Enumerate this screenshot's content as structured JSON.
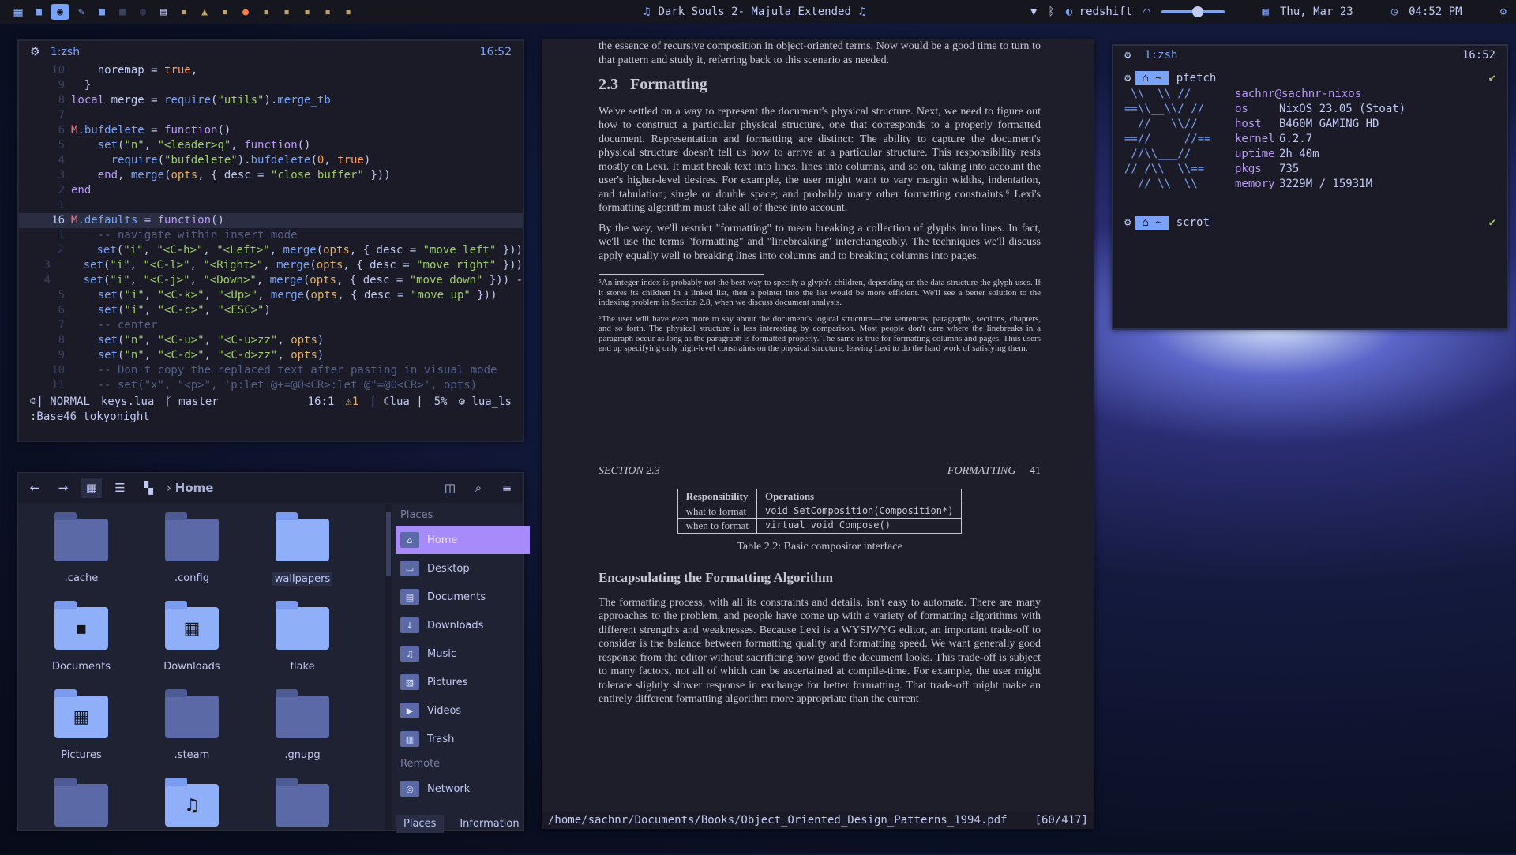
{
  "topbar": {
    "workspace_count": 16,
    "media": "Dark Souls 2- Majula Extended",
    "redshift": "redshift",
    "volume_level": 0.58,
    "date": "Thu, Mar 23",
    "time": "04:52 PM"
  },
  "editor": {
    "title": "1:zsh",
    "clock": "16:52",
    "lines": [
      {
        "n": "10",
        "segs": [
          [
            "o",
            "    noremap = "
          ],
          [
            "b",
            "true"
          ],
          [
            "o",
            ","
          ]
        ]
      },
      {
        "n": "9",
        "segs": [
          [
            "o",
            "  }"
          ]
        ]
      },
      {
        "n": "8",
        "segs": [
          [
            "k",
            "local "
          ],
          [
            "o",
            "merge = "
          ],
          [
            "f",
            "require"
          ],
          [
            "o",
            "("
          ],
          [
            "s",
            "\"utils\""
          ],
          [
            "o",
            ")."
          ],
          [
            "f",
            "merge_tb"
          ]
        ]
      },
      {
        "n": "7",
        "segs": []
      },
      {
        "n": "6",
        "segs": [
          [
            "r",
            "M"
          ],
          [
            "o",
            "."
          ],
          [
            "f",
            "bufdelete"
          ],
          [
            "o",
            " = "
          ],
          [
            "k",
            "function"
          ],
          [
            "o",
            "()"
          ]
        ]
      },
      {
        "n": "5",
        "segs": [
          [
            "o",
            "    "
          ],
          [
            "f",
            "set"
          ],
          [
            "o",
            "("
          ],
          [
            "s",
            "\"n\""
          ],
          [
            "o",
            ", "
          ],
          [
            "s",
            "\"<leader>q\""
          ],
          [
            "o",
            ", "
          ],
          [
            "k",
            "function"
          ],
          [
            "o",
            "()"
          ]
        ]
      },
      {
        "n": "4",
        "segs": [
          [
            "o",
            "      "
          ],
          [
            "f",
            "require"
          ],
          [
            "o",
            "("
          ],
          [
            "s",
            "\"bufdelete\""
          ],
          [
            "o",
            ")."
          ],
          [
            "f",
            "bufdelete"
          ],
          [
            "o",
            "("
          ],
          [
            "b",
            "0"
          ],
          [
            "o",
            ", "
          ],
          [
            "b",
            "true"
          ],
          [
            "o",
            ")"
          ]
        ]
      },
      {
        "n": "3",
        "segs": [
          [
            "o",
            "    "
          ],
          [
            "k",
            "end"
          ],
          [
            "o",
            ", "
          ],
          [
            "f",
            "merge"
          ],
          [
            "o",
            "("
          ],
          [
            "y",
            "opts"
          ],
          [
            "o",
            ", { desc = "
          ],
          [
            "s",
            "\"close buffer\""
          ],
          [
            "o",
            " }))"
          ]
        ]
      },
      {
        "n": "2",
        "segs": [
          [
            "k",
            "end"
          ]
        ]
      },
      {
        "n": "1",
        "segs": []
      },
      {
        "n": "16",
        "cur": true,
        "segs": [
          [
            "r",
            "M"
          ],
          [
            "o",
            "."
          ],
          [
            "f",
            "defaults"
          ],
          [
            "o",
            " = "
          ],
          [
            "k",
            "function"
          ],
          [
            "o",
            "()"
          ]
        ]
      },
      {
        "n": "1",
        "segs": [
          [
            "c",
            "    -- navigate within insert mode"
          ]
        ]
      },
      {
        "n": "2",
        "segs": [
          [
            "o",
            "    "
          ],
          [
            "f",
            "set"
          ],
          [
            "o",
            "("
          ],
          [
            "s",
            "\"i\""
          ],
          [
            "o",
            ", "
          ],
          [
            "s",
            "\"<C-h>\""
          ],
          [
            "o",
            ", "
          ],
          [
            "s",
            "\"<Left>\""
          ],
          [
            "o",
            ", "
          ],
          [
            "f",
            "merge"
          ],
          [
            "o",
            "("
          ],
          [
            "y",
            "opts"
          ],
          [
            "o",
            ", { desc = "
          ],
          [
            "s",
            "\"move left\""
          ],
          [
            "o",
            " }))"
          ]
        ]
      },
      {
        "n": "3",
        "segs": [
          [
            "o",
            "    "
          ],
          [
            "f",
            "set"
          ],
          [
            "o",
            "("
          ],
          [
            "s",
            "\"i\""
          ],
          [
            "o",
            ", "
          ],
          [
            "s",
            "\"<C-l>\""
          ],
          [
            "o",
            ", "
          ],
          [
            "s",
            "\"<Right>\""
          ],
          [
            "o",
            ", "
          ],
          [
            "f",
            "merge"
          ],
          [
            "o",
            "("
          ],
          [
            "y",
            "opts"
          ],
          [
            "o",
            ", { desc = "
          ],
          [
            "s",
            "\"move right\""
          ],
          [
            "o",
            " }))"
          ]
        ]
      },
      {
        "n": "4",
        "segs": [
          [
            "o",
            "    "
          ],
          [
            "f",
            "set"
          ],
          [
            "o",
            "("
          ],
          [
            "s",
            "\"i\""
          ],
          [
            "o",
            ", "
          ],
          [
            "s",
            "\"<C-j>\""
          ],
          [
            "o",
            ", "
          ],
          [
            "s",
            "\"<Down>\""
          ],
          [
            "o",
            ", "
          ],
          [
            "f",
            "merge"
          ],
          [
            "o",
            "("
          ],
          [
            "y",
            "opts"
          ],
          [
            "o",
            ", { desc = "
          ],
          [
            "s",
            "\"move down\""
          ],
          [
            "o",
            " })) -"
          ]
        ]
      },
      {
        "n": "5",
        "segs": [
          [
            "o",
            "    "
          ],
          [
            "f",
            "set"
          ],
          [
            "o",
            "("
          ],
          [
            "s",
            "\"i\""
          ],
          [
            "o",
            ", "
          ],
          [
            "s",
            "\"<C-k>\""
          ],
          [
            "o",
            ", "
          ],
          [
            "s",
            "\"<Up>\""
          ],
          [
            "o",
            ", "
          ],
          [
            "f",
            "merge"
          ],
          [
            "o",
            "("
          ],
          [
            "y",
            "opts"
          ],
          [
            "o",
            ", { desc = "
          ],
          [
            "s",
            "\"move up\""
          ],
          [
            "o",
            " }))"
          ]
        ]
      },
      {
        "n": "6",
        "segs": [
          [
            "o",
            "    "
          ],
          [
            "f",
            "set"
          ],
          [
            "o",
            "("
          ],
          [
            "s",
            "\"i\""
          ],
          [
            "o",
            ", "
          ],
          [
            "s",
            "\"<C-c>\""
          ],
          [
            "o",
            ", "
          ],
          [
            "s",
            "\"<ESC>\""
          ],
          [
            "o",
            ")"
          ]
        ]
      },
      {
        "n": "7",
        "segs": [
          [
            "c",
            "    -- center"
          ]
        ]
      },
      {
        "n": "8",
        "segs": [
          [
            "o",
            "    "
          ],
          [
            "f",
            "set"
          ],
          [
            "o",
            "("
          ],
          [
            "s",
            "\"n\""
          ],
          [
            "o",
            ", "
          ],
          [
            "s",
            "\"<C-u>\""
          ],
          [
            "o",
            ", "
          ],
          [
            "s",
            "\"<C-u>zz\""
          ],
          [
            "o",
            ", "
          ],
          [
            "y",
            "opts"
          ],
          [
            "o",
            ")"
          ]
        ]
      },
      {
        "n": "9",
        "segs": [
          [
            "o",
            "    "
          ],
          [
            "f",
            "set"
          ],
          [
            "o",
            "("
          ],
          [
            "s",
            "\"n\""
          ],
          [
            "o",
            ", "
          ],
          [
            "s",
            "\"<C-d>\""
          ],
          [
            "o",
            ", "
          ],
          [
            "s",
            "\"<C-d>zz\""
          ],
          [
            "o",
            ", "
          ],
          [
            "y",
            "opts"
          ],
          [
            "o",
            ")"
          ]
        ]
      },
      {
        "n": "10",
        "segs": [
          [
            "c",
            "    -- Don't copy the replaced text after pasting in visual mode"
          ]
        ]
      },
      {
        "n": "11",
        "segs": [
          [
            "c",
            "    -- set(\"x\", \"<p>\", 'p:let @+=@0<CR>:let @\"=@0<CR>', opts)"
          ]
        ]
      }
    ],
    "status": {
      "mode": "NORMAL",
      "file": "keys.lua",
      "branch": "master",
      "position": "16:1",
      "warnings": "1",
      "lang": "lua",
      "percent": "5%",
      "lsp": "lua_ls"
    },
    "cmdline": ":Base46 tokyonight"
  },
  "files": {
    "breadcrumb": "Home",
    "items": [
      {
        "label": ".cache",
        "glyph": "",
        "hl": false,
        "sel": false
      },
      {
        "label": ".config",
        "glyph": "",
        "hl": false,
        "sel": false
      },
      {
        "label": "wallpapers",
        "glyph": "",
        "hl": true,
        "sel": true
      },
      {
        "label": "Documents",
        "glyph": "▪",
        "hl": true,
        "sel": false
      },
      {
        "label": "Downloads",
        "glyph": "▦",
        "hl": true,
        "sel": false
      },
      {
        "label": "flake",
        "glyph": "",
        "hl": true,
        "sel": false
      },
      {
        "label": "Pictures",
        "glyph": "▦",
        "hl": true,
        "sel": false
      },
      {
        "label": ".steam",
        "glyph": "",
        "hl": false,
        "sel": false
      },
      {
        "label": ".gnupg",
        "glyph": "",
        "hl": false,
        "sel": false
      },
      {
        "label": "",
        "glyph": "",
        "hl": false,
        "sel": false
      },
      {
        "label": "",
        "glyph": "♫",
        "hl": true,
        "sel": false
      },
      {
        "label": "",
        "glyph": "",
        "hl": false,
        "sel": false
      }
    ],
    "places_title": "Places",
    "places": [
      {
        "label": "Home",
        "icon": "⌂",
        "active": true
      },
      {
        "label": "Desktop",
        "icon": "▭",
        "active": false
      },
      {
        "label": "Documents",
        "icon": "▤",
        "active": false
      },
      {
        "label": "Downloads",
        "icon": "↓",
        "active": false
      },
      {
        "label": "Music",
        "icon": "♫",
        "active": false
      },
      {
        "label": "Pictures",
        "icon": "▨",
        "active": false
      },
      {
        "label": "Videos",
        "icon": "▶",
        "active": false
      },
      {
        "label": "Trash",
        "icon": "▥",
        "active": false
      }
    ],
    "remote_title": "Remote",
    "remote": [
      {
        "label": "Network",
        "icon": "◎"
      }
    ],
    "tabs": [
      "Places",
      "Information"
    ]
  },
  "pdf": {
    "intro": "the essence of recursive composition in object-oriented terms. Now would be a good time to turn to that pattern and study it, referring back to this scenario as needed.",
    "section_num": "2.3",
    "section_title": "Formatting",
    "p1": "We've settled on a way to represent the document's physical structure. Next, we need to figure out how to construct a particular physical structure, one that corresponds to a properly formatted document. Representation and formatting are distinct: The ability to capture the document's physical structure doesn't tell us how to arrive at a particular structure. This responsibility rests mostly on Lexi. It must break text into lines, lines into columns, and so on, taking into account the user's higher-level desires. For example, the user might want to vary margin widths, indentation, and tabulation; single or double space; and probably many other formatting constraints.⁶ Lexi's formatting algorithm must take all of these into account.",
    "p2": "By the way, we'll restrict \"formatting\" to mean breaking a collection of glyphs into lines. In fact, we'll use the terms \"formatting\" and \"linebreaking\" interchangeably. The techniques we'll discuss apply equally well to breaking lines into columns and to breaking columns into pages.",
    "fn5": "⁵An integer index is probably not the best way to specify a glyph's children, depending on the data structure the glyph uses. If it stores its children in a linked list, then a pointer into the list would be more efficient. We'll see a better solution to the indexing problem in Section 2.8, when we discuss document analysis.",
    "fn6": "⁶The user will have even more to say about the document's logical structure—the sentences, paragraphs, sections, chapters, and so forth. The physical structure is less interesting by comparison. Most people don't care where the linebreaks in a paragraph occur as long as the paragraph is formatted properly. The same is true for formatting columns and pages. Thus users end up specifying only high-level constraints on the physical structure, leaving Lexi to do the hard work of satisfying them.",
    "running_left": "SECTION 2.3",
    "running_right": "FORMATTING",
    "page_num": "41",
    "table_h1": "Responsibility",
    "table_h2": "Operations",
    "table_r1a": "what to format",
    "table_r1b": "void SetComposition(Composition*)",
    "table_r2a": "when to format",
    "table_r2b": "virtual void Compose()",
    "table_caption": "Table 2.2: Basic compositor interface",
    "h3": "Encapsulating the Formatting Algorithm",
    "p3": "The formatting process, with all its constraints and details, isn't easy to automate. There are many approaches to the problem, and people have come up with a variety of formatting algorithms with different strengths and weaknesses. Because Lexi is a WYSIWYG editor, an important trade-off to consider is the balance between formatting quality and formatting speed. We want generally good response from the editor without sacrificing how good the document looks. This trade-off is subject to many factors, not all of which can be ascertained at compile-time. For example, the user might tolerate slightly slower response in exchange for better formatting. That trade-off might make an entirely different formatting algorithm more appropriate than the current",
    "path": "/home/sachnr/Documents/Books/Object_Oriented_Design_Patterns_1994.pdf",
    "pages": "[60/417]"
  },
  "term": {
    "title": "1:zsh",
    "clock": "16:52",
    "cmd1": "pfetch",
    "user": "sachnr@sachnr-nixos",
    "art": [
      " \\\\  \\\\ //",
      "==\\\\__\\\\/ //",
      "  //   \\\\//",
      "==//     //==",
      " //\\\\___//",
      "// /\\\\  \\\\==",
      "  // \\\\  \\\\"
    ],
    "info": [
      {
        "k": "os",
        "v": "NixOS 23.05 (Stoat)"
      },
      {
        "k": "host",
        "v": "B460M GAMING HD"
      },
      {
        "k": "kernel",
        "v": "6.2.7"
      },
      {
        "k": "uptime",
        "v": "2h 40m"
      },
      {
        "k": "pkgs",
        "v": "735"
      },
      {
        "k": "memory",
        "v": "3229M / 15931M"
      }
    ],
    "cmd2": "scrot",
    "check": "✔",
    "home": "⌂ ~"
  }
}
